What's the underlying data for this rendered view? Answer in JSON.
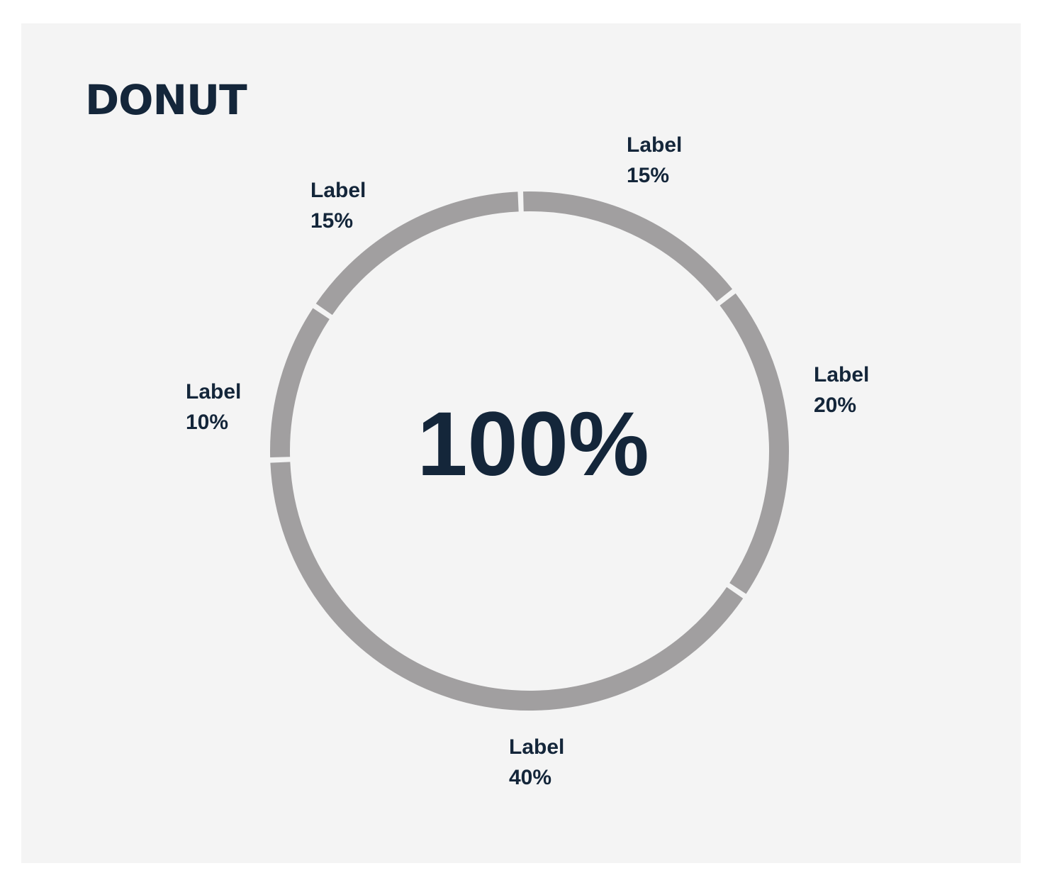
{
  "colors": {
    "text": "#14263a",
    "segment": "#a19fa0",
    "gap": "#f4f4f4"
  },
  "chart_data": {
    "type": "pie",
    "title": "DONUT",
    "center_label": "100%",
    "slices": [
      {
        "label": "Label",
        "value": 15,
        "value_label": "15%"
      },
      {
        "label": "Label",
        "value": 20,
        "value_label": "20%"
      },
      {
        "label": "Label",
        "value": 40,
        "value_label": "40%"
      },
      {
        "label": "Label",
        "value": 10,
        "value_label": "10%"
      },
      {
        "label": "Label",
        "value": 15,
        "value_label": "15%"
      }
    ]
  }
}
